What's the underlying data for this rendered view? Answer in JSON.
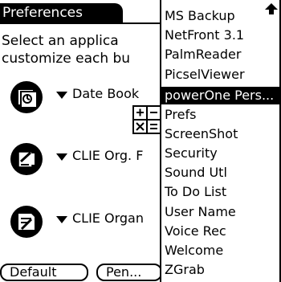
{
  "header": {
    "title": "Preferences"
  },
  "instructions": {
    "line1": "Select an applica",
    "line2": "customize each bu"
  },
  "apps": [
    {
      "name": "Date Book",
      "icon": "datebook-icon"
    },
    {
      "name": "CLIE Org. F",
      "icon": "clie-org-icon"
    },
    {
      "name": "CLIE Organ",
      "icon": "clie-organizer-icon"
    }
  ],
  "buttons": {
    "default_label": "Default",
    "pen_label": "Pen..."
  },
  "dropdown": {
    "items": [
      "MS Backup",
      "NetFront 3.1",
      "PalmReader",
      "PicselViewer",
      "powerOne Pers...",
      "Prefs",
      "ScreenShot",
      "Security",
      "Sound Utl",
      "To Do List",
      "User Name",
      "Voice Rec",
      "Welcome",
      "ZGrab"
    ],
    "selected_index": 4
  }
}
